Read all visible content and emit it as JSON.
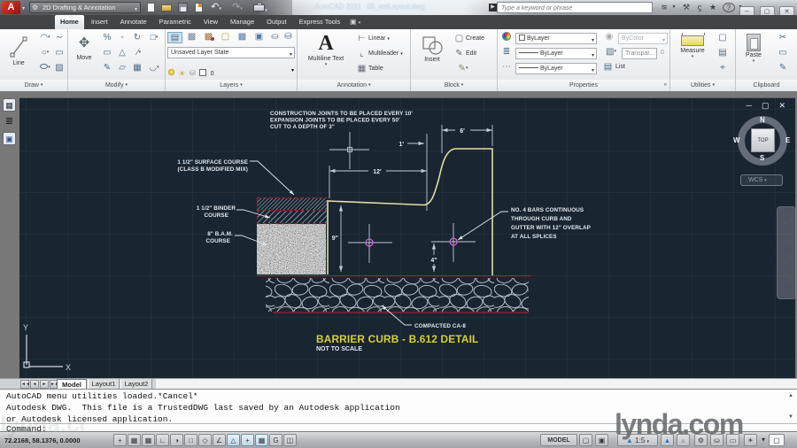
{
  "title_bar": {
    "logo": "A",
    "workspace": "2D Drafting & Annotation",
    "app_title": "AutoCAD 2011",
    "doc_name": "05_extLayout.dwg",
    "search_placeholder": "Type a keyword or phrase"
  },
  "ribbon_tabs": {
    "items": [
      "Home",
      "Insert",
      "Annotate",
      "Parametric",
      "View",
      "Manage",
      "Output",
      "Express Tools"
    ],
    "active": "Home"
  },
  "ribbon": {
    "draw": {
      "tool": "Line",
      "footer": "Draw"
    },
    "modify": {
      "tool": "Move",
      "footer": "Modify"
    },
    "layers": {
      "state": "Unsaved Layer State",
      "current": "0",
      "footer": "Layers"
    },
    "annotation": {
      "tool": "Multiline Text",
      "row1": "Linear",
      "row2": "Multileader",
      "row3": "Table",
      "footer": "Annotation"
    },
    "block": {
      "tool": "Insert",
      "row1": "Create",
      "row2": "Edit",
      "footer": "Block"
    },
    "properties": {
      "color": "ByLayer",
      "bycolor": "ByColor",
      "lineweight": "ByLayer",
      "linetype": "ByLayer",
      "transparency": "Transpar...",
      "trans_value": "0",
      "list": "List",
      "footer": "Properties"
    },
    "utilities": {
      "tool": "Measure",
      "footer": "Utilities"
    },
    "clipboard": {
      "tool": "Paste",
      "footer": "Clipboard"
    }
  },
  "drawing": {
    "note_construction": [
      "CONSTRUCTION JOINTS TO BE PLACED EVERY 10'",
      "EXPANSION JOINTS TO BE PLACED EVERY 50'",
      "CUT TO A DEPTH OF 3\""
    ],
    "note_surface": [
      "1 1/2\" SURFACE COURSE",
      "(CLASS B MODIFIED MIX)"
    ],
    "note_binder": [
      "1 1/2\" BINDER",
      "COURSE"
    ],
    "note_bam": [
      "8\" B.A.M.",
      "COURSE"
    ],
    "note_bars": [
      "NO. 4 BARS CONTINUOUS",
      "THROUGH CURB AND",
      "GUTTER WITH 12\" OVERLAP",
      "AT ALL SPLICES"
    ],
    "note_compacted": "COMPACTED CA-8",
    "dim_6": "6'",
    "dim_1": "1'",
    "dim_12": "12'",
    "dim_9": "9\"",
    "dim_4": "4\"",
    "title": "BARRIER CURB - B.612 DETAIL",
    "subtitle": "NOT TO SCALE",
    "ucs_x": "X",
    "ucs_y": "Y",
    "colors": {
      "canvas": "#192531",
      "line_yellow": "#dfe0a0",
      "line_red": "#8c1420",
      "dim_gray": "#c3cad2",
      "bar_magenta": "#d863d8",
      "title_yellow": "#d8cf35"
    }
  },
  "viewcube": {
    "n": "N",
    "e": "E",
    "s": "S",
    "w": "W",
    "top": "TOP",
    "wcs": "WCS"
  },
  "layout_tabs": {
    "items": [
      "Model",
      "Layout1",
      "Layout2"
    ],
    "active": "Model"
  },
  "command": {
    "lines": [
      "AutoCAD menu utilities loaded.*Cancel*",
      "Autodesk DWG.  This file is a TrustedDWG last saved by an Autodesk application",
      "or Autodesk licensed application."
    ],
    "prompt": "Command:"
  },
  "status_bar": {
    "coords": "72.2168, 58.1376, 0.0000",
    "model_label": "MODEL",
    "annotation_scale": "1:5"
  },
  "watermark": "lynda.com"
}
